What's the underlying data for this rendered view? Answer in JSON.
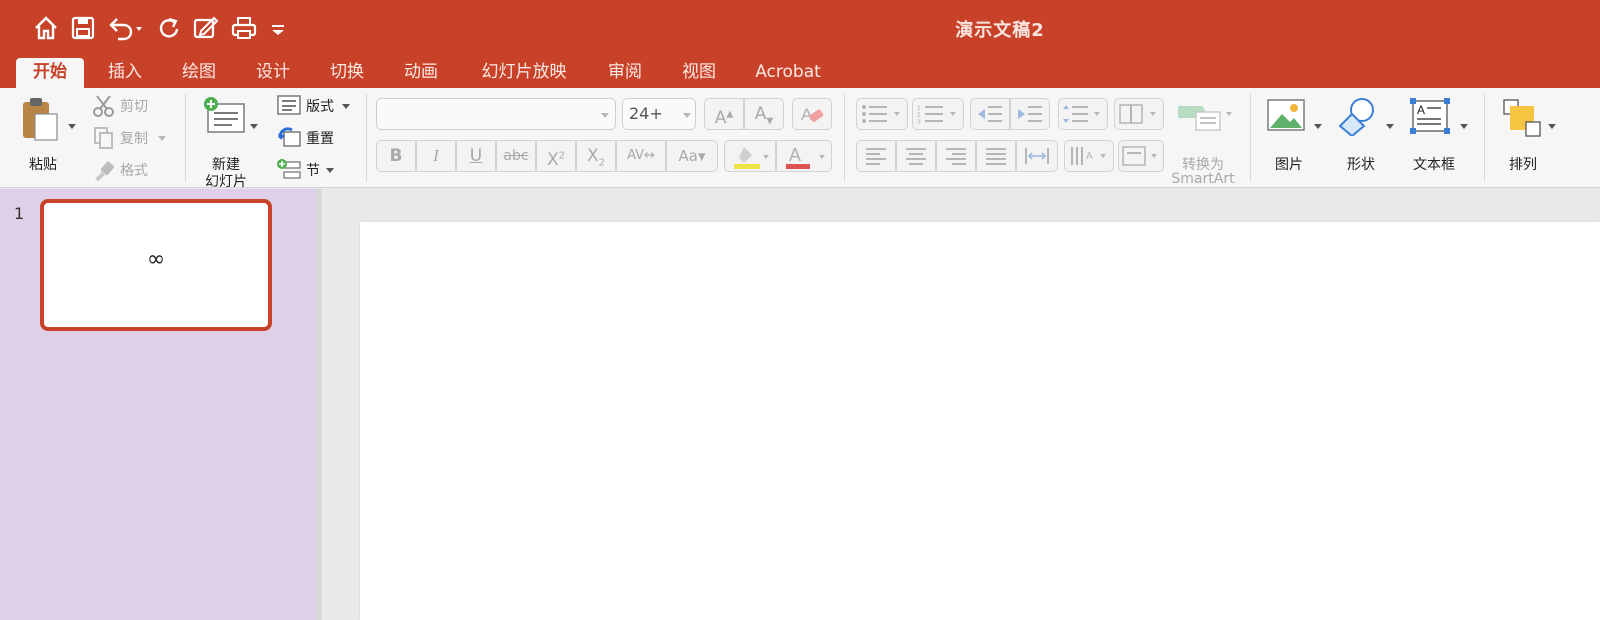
{
  "window": {
    "title": "演示文稿2"
  },
  "tabs": [
    "开始",
    "插入",
    "绘图",
    "设计",
    "切换",
    "动画",
    "幻灯片放映",
    "审阅",
    "视图",
    "Acrobat"
  ],
  "clipboard": {
    "paste": "粘贴",
    "cut": "剪切",
    "copy": "复制",
    "format": "格式"
  },
  "slides": {
    "new_slide_line1": "新建",
    "new_slide_line2": "幻灯片",
    "layout": "版式",
    "reset": "重置",
    "section": "节"
  },
  "font": {
    "name_value": "",
    "size_value": "24+"
  },
  "paragraph": {
    "smartart_line1": "转换为",
    "smartart_line2": "SmartArt"
  },
  "insert": {
    "picture": "图片",
    "shapes": "形状",
    "textbox": "文本框",
    "arrange": "排列"
  },
  "slide_list": [
    {
      "number": "1",
      "content": "∞"
    }
  ],
  "colors": {
    "accent": "#c8422a",
    "pane": "#e0cfe8",
    "highlight": "#f2e34a",
    "font_red": "#e05252"
  }
}
